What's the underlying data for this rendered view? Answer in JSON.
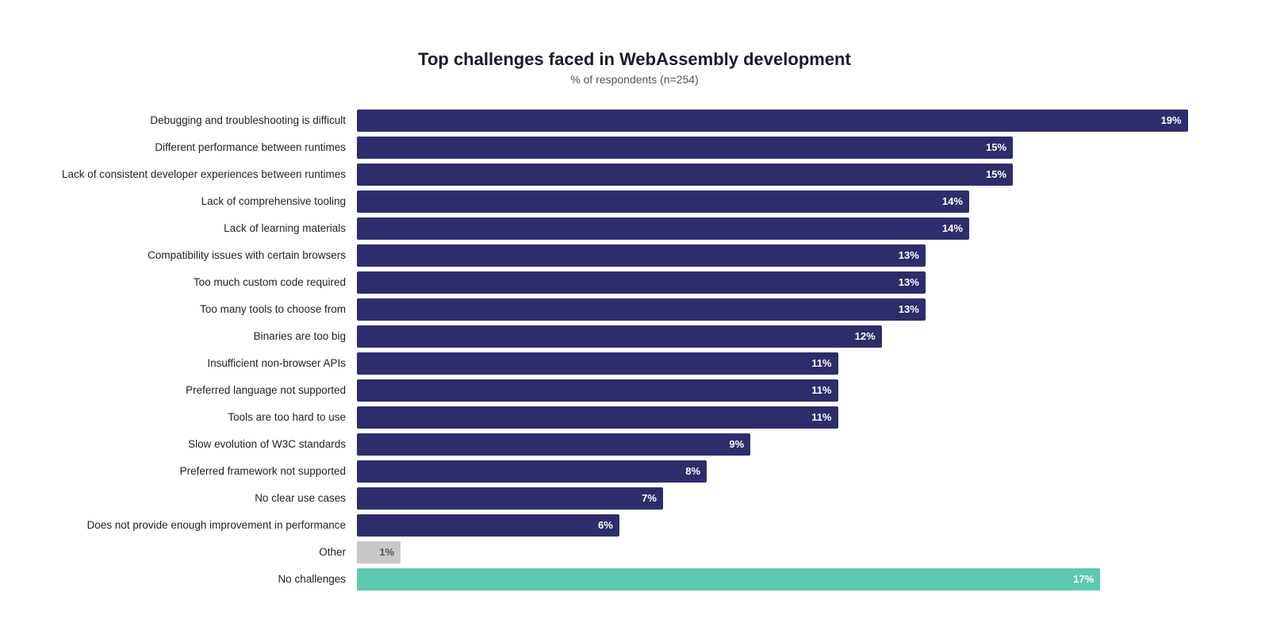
{
  "title": "Top challenges faced in WebAssembly development",
  "subtitle": "% of respondents (n=254)",
  "maxPct": 19,
  "bars": [
    {
      "label": "Debugging and troubleshooting is difficult",
      "pct": 19,
      "type": "dark-blue"
    },
    {
      "label": "Different performance between runtimes",
      "pct": 15,
      "type": "dark-blue"
    },
    {
      "label": "Lack of consistent developer experiences between runtimes",
      "pct": 15,
      "type": "dark-blue"
    },
    {
      "label": "Lack of comprehensive tooling",
      "pct": 14,
      "type": "dark-blue"
    },
    {
      "label": "Lack of learning materials",
      "pct": 14,
      "type": "dark-blue"
    },
    {
      "label": "Compatibility issues with certain browsers",
      "pct": 13,
      "type": "dark-blue"
    },
    {
      "label": "Too much custom code required",
      "pct": 13,
      "type": "dark-blue"
    },
    {
      "label": "Too many tools to choose from",
      "pct": 13,
      "type": "dark-blue"
    },
    {
      "label": "Binaries are too big",
      "pct": 12,
      "type": "dark-blue"
    },
    {
      "label": "Insufficient non-browser APIs",
      "pct": 11,
      "type": "dark-blue"
    },
    {
      "label": "Preferred language not supported",
      "pct": 11,
      "type": "dark-blue"
    },
    {
      "label": "Tools are too hard to use",
      "pct": 11,
      "type": "dark-blue"
    },
    {
      "label": "Slow evolution of W3C standards",
      "pct": 9,
      "type": "dark-blue"
    },
    {
      "label": "Preferred framework not supported",
      "pct": 8,
      "type": "dark-blue"
    },
    {
      "label": "No clear use cases",
      "pct": 7,
      "type": "dark-blue"
    },
    {
      "label": "Does not provide enough improvement in performance",
      "pct": 6,
      "type": "dark-blue"
    },
    {
      "label": "Other",
      "pct": 1,
      "type": "gray"
    },
    {
      "label": "No challenges",
      "pct": 17,
      "type": "teal"
    }
  ]
}
